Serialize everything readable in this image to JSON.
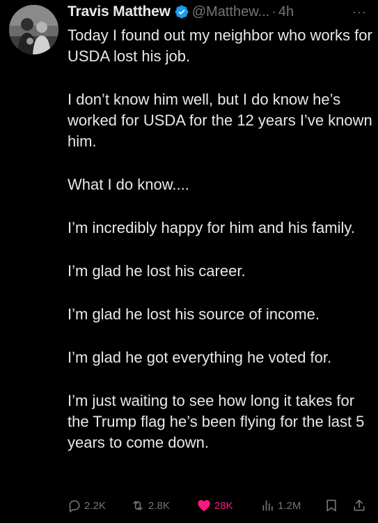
{
  "author": {
    "name": "Travis Matthew",
    "handle": "@Matthew...",
    "separator": "·",
    "time": "4h",
    "verified": true,
    "verified_color": "#1d9bf0"
  },
  "more_label": "···",
  "paragraphs": [
    "Today I found out my neighbor who works for USDA lost his job.",
    "I don’t know him well, but I do know he’s worked for USDA for the 12 years I’ve known him.",
    "What I do know....",
    "I’m incredibly happy for him and his family.",
    "I’m glad he lost his career.",
    "I’m glad he lost his source of income.",
    "I’m glad he got everything he voted for.",
    "I’m just waiting to see how long it takes for the Trump flag he’s been flying for the last 5 years to come down."
  ],
  "actions": {
    "reply": {
      "icon": "reply-icon",
      "count": "2.2K"
    },
    "retweet": {
      "icon": "retweet-icon",
      "count": "2.8K"
    },
    "like": {
      "icon": "heart-icon",
      "count": "28K",
      "active": true,
      "color": "#f91880"
    },
    "views": {
      "icon": "views-icon",
      "count": "1.2M"
    },
    "bookmark": {
      "icon": "bookmark-icon"
    },
    "share": {
      "icon": "share-icon"
    }
  },
  "colors": {
    "background": "#000000",
    "text": "#e7e9ea",
    "secondary": "#71767b",
    "accent": "#1d9bf0"
  }
}
